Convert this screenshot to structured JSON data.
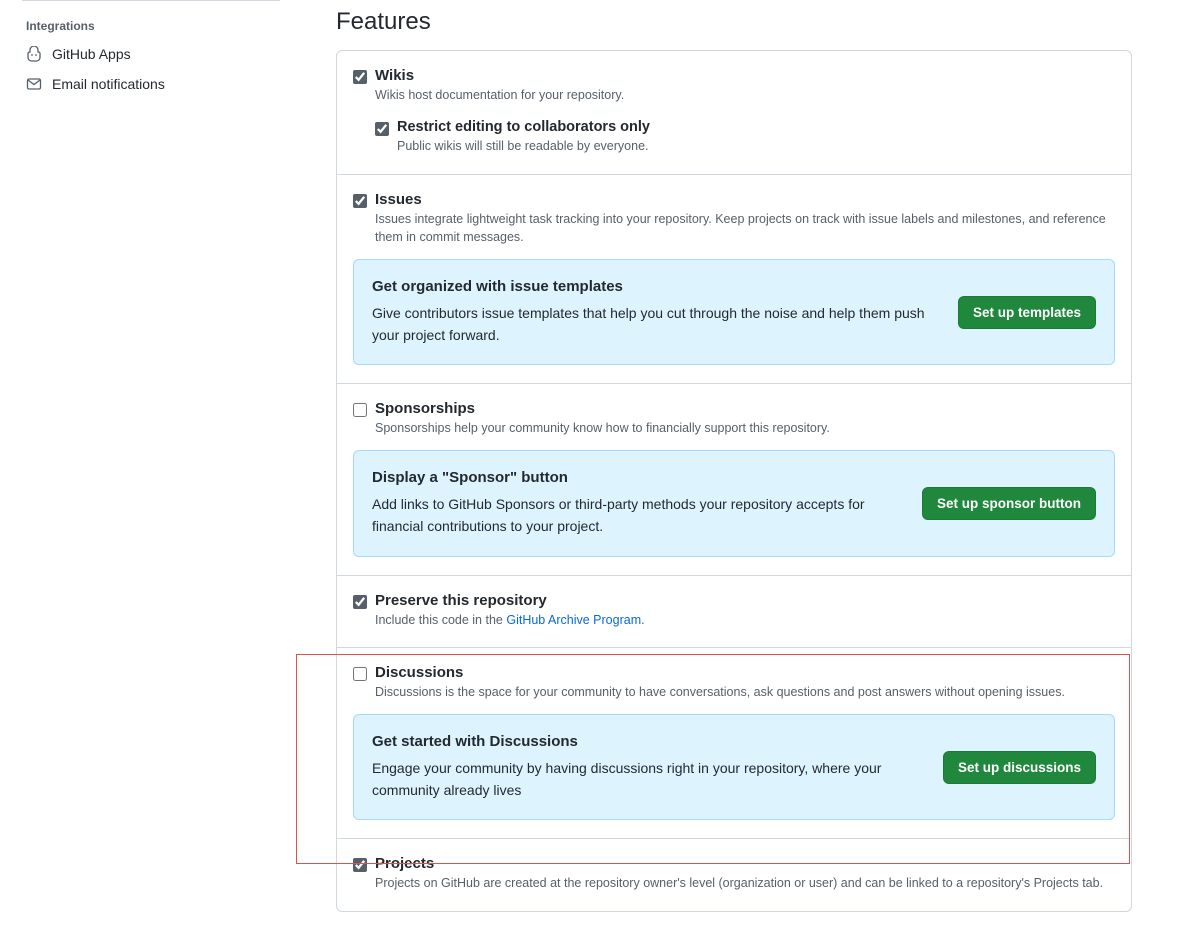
{
  "sidebar": {
    "heading": "Integrations",
    "items": [
      {
        "label": "GitHub Apps"
      },
      {
        "label": "Email notifications"
      }
    ]
  },
  "main": {
    "title": "Features",
    "features": {
      "wikis": {
        "label": "Wikis",
        "desc": "Wikis host documentation for your repository.",
        "sub": {
          "label": "Restrict editing to collaborators only",
          "desc": "Public wikis will still be readable by everyone."
        }
      },
      "issues": {
        "label": "Issues",
        "desc": "Issues integrate lightweight task tracking into your repository. Keep projects on track with issue labels and milestones, and reference them in commit messages.",
        "callout_title": "Get organized with issue templates",
        "callout_desc": "Give contributors issue templates that help you cut through the noise and help them push your project forward.",
        "button": "Set up templates"
      },
      "sponsorships": {
        "label": "Sponsorships",
        "desc": "Sponsorships help your community know how to financially support this repository.",
        "callout_title": "Display a \"Sponsor\" button",
        "callout_desc": "Add links to GitHub Sponsors or third-party methods your repository accepts for financial contributions to your project.",
        "button": "Set up sponsor button"
      },
      "preserve": {
        "label": "Preserve this repository",
        "desc_prefix": "Include this code in the ",
        "desc_link": "GitHub Archive Program",
        "desc_suffix": "."
      },
      "discussions": {
        "label": "Discussions",
        "desc": "Discussions is the space for your community to have conversations, ask questions and post answers without opening issues.",
        "callout_title": "Get started with Discussions",
        "callout_desc": "Engage your community by having discussions right in your repository, where your community already lives",
        "button": "Set up discussions"
      },
      "projects": {
        "label": "Projects",
        "desc": "Projects on GitHub are created at the repository owner's level (organization or user) and can be linked to a repository's Projects tab."
      }
    }
  }
}
